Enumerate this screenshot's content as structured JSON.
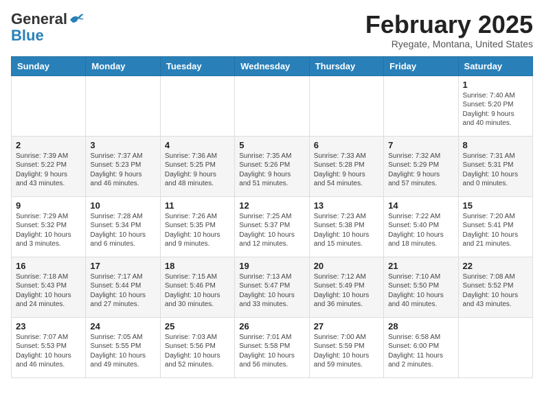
{
  "header": {
    "logo_general": "General",
    "logo_blue": "Blue",
    "title": "February 2025",
    "subtitle": "Ryegate, Montana, United States"
  },
  "weekdays": [
    "Sunday",
    "Monday",
    "Tuesday",
    "Wednesday",
    "Thursday",
    "Friday",
    "Saturday"
  ],
  "weeks": [
    [
      {
        "day": "",
        "info": ""
      },
      {
        "day": "",
        "info": ""
      },
      {
        "day": "",
        "info": ""
      },
      {
        "day": "",
        "info": ""
      },
      {
        "day": "",
        "info": ""
      },
      {
        "day": "",
        "info": ""
      },
      {
        "day": "1",
        "info": "Sunrise: 7:40 AM\nSunset: 5:20 PM\nDaylight: 9 hours\nand 40 minutes."
      }
    ],
    [
      {
        "day": "2",
        "info": "Sunrise: 7:39 AM\nSunset: 5:22 PM\nDaylight: 9 hours\nand 43 minutes."
      },
      {
        "day": "3",
        "info": "Sunrise: 7:37 AM\nSunset: 5:23 PM\nDaylight: 9 hours\nand 46 minutes."
      },
      {
        "day": "4",
        "info": "Sunrise: 7:36 AM\nSunset: 5:25 PM\nDaylight: 9 hours\nand 48 minutes."
      },
      {
        "day": "5",
        "info": "Sunrise: 7:35 AM\nSunset: 5:26 PM\nDaylight: 9 hours\nand 51 minutes."
      },
      {
        "day": "6",
        "info": "Sunrise: 7:33 AM\nSunset: 5:28 PM\nDaylight: 9 hours\nand 54 minutes."
      },
      {
        "day": "7",
        "info": "Sunrise: 7:32 AM\nSunset: 5:29 PM\nDaylight: 9 hours\nand 57 minutes."
      },
      {
        "day": "8",
        "info": "Sunrise: 7:31 AM\nSunset: 5:31 PM\nDaylight: 10 hours\nand 0 minutes."
      }
    ],
    [
      {
        "day": "9",
        "info": "Sunrise: 7:29 AM\nSunset: 5:32 PM\nDaylight: 10 hours\nand 3 minutes."
      },
      {
        "day": "10",
        "info": "Sunrise: 7:28 AM\nSunset: 5:34 PM\nDaylight: 10 hours\nand 6 minutes."
      },
      {
        "day": "11",
        "info": "Sunrise: 7:26 AM\nSunset: 5:35 PM\nDaylight: 10 hours\nand 9 minutes."
      },
      {
        "day": "12",
        "info": "Sunrise: 7:25 AM\nSunset: 5:37 PM\nDaylight: 10 hours\nand 12 minutes."
      },
      {
        "day": "13",
        "info": "Sunrise: 7:23 AM\nSunset: 5:38 PM\nDaylight: 10 hours\nand 15 minutes."
      },
      {
        "day": "14",
        "info": "Sunrise: 7:22 AM\nSunset: 5:40 PM\nDaylight: 10 hours\nand 18 minutes."
      },
      {
        "day": "15",
        "info": "Sunrise: 7:20 AM\nSunset: 5:41 PM\nDaylight: 10 hours\nand 21 minutes."
      }
    ],
    [
      {
        "day": "16",
        "info": "Sunrise: 7:18 AM\nSunset: 5:43 PM\nDaylight: 10 hours\nand 24 minutes."
      },
      {
        "day": "17",
        "info": "Sunrise: 7:17 AM\nSunset: 5:44 PM\nDaylight: 10 hours\nand 27 minutes."
      },
      {
        "day": "18",
        "info": "Sunrise: 7:15 AM\nSunset: 5:46 PM\nDaylight: 10 hours\nand 30 minutes."
      },
      {
        "day": "19",
        "info": "Sunrise: 7:13 AM\nSunset: 5:47 PM\nDaylight: 10 hours\nand 33 minutes."
      },
      {
        "day": "20",
        "info": "Sunrise: 7:12 AM\nSunset: 5:49 PM\nDaylight: 10 hours\nand 36 minutes."
      },
      {
        "day": "21",
        "info": "Sunrise: 7:10 AM\nSunset: 5:50 PM\nDaylight: 10 hours\nand 40 minutes."
      },
      {
        "day": "22",
        "info": "Sunrise: 7:08 AM\nSunset: 5:52 PM\nDaylight: 10 hours\nand 43 minutes."
      }
    ],
    [
      {
        "day": "23",
        "info": "Sunrise: 7:07 AM\nSunset: 5:53 PM\nDaylight: 10 hours\nand 46 minutes."
      },
      {
        "day": "24",
        "info": "Sunrise: 7:05 AM\nSunset: 5:55 PM\nDaylight: 10 hours\nand 49 minutes."
      },
      {
        "day": "25",
        "info": "Sunrise: 7:03 AM\nSunset: 5:56 PM\nDaylight: 10 hours\nand 52 minutes."
      },
      {
        "day": "26",
        "info": "Sunrise: 7:01 AM\nSunset: 5:58 PM\nDaylight: 10 hours\nand 56 minutes."
      },
      {
        "day": "27",
        "info": "Sunrise: 7:00 AM\nSunset: 5:59 PM\nDaylight: 10 hours\nand 59 minutes."
      },
      {
        "day": "28",
        "info": "Sunrise: 6:58 AM\nSunset: 6:00 PM\nDaylight: 11 hours\nand 2 minutes."
      },
      {
        "day": "",
        "info": ""
      }
    ]
  ]
}
